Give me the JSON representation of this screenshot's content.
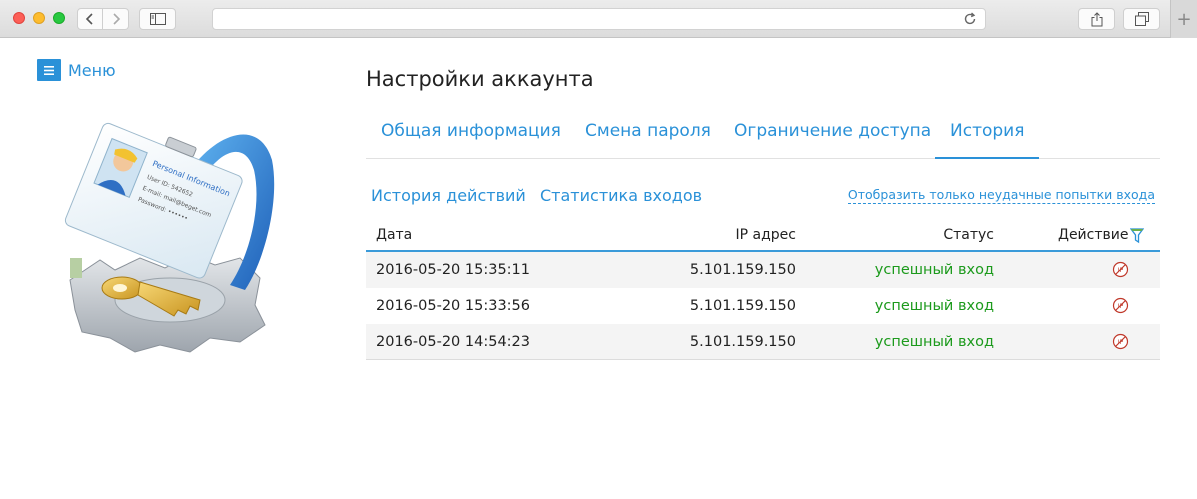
{
  "browser": {
    "new_tab_glyph": "+"
  },
  "menu": {
    "label": "Меню",
    "icon": "hamburger-icon"
  },
  "page": {
    "title": "Настройки аккаунта"
  },
  "tabs": [
    {
      "label": "Общая информация",
      "active": false
    },
    {
      "label": "Смена пароля",
      "active": false
    },
    {
      "label": "Ограничение доступа",
      "active": false
    },
    {
      "label": "История",
      "active": true
    }
  ],
  "subtabs": {
    "actions_history": "История действий",
    "login_stats": "Статистика входов",
    "failed_only_link": "Отобразить только неудачные попытки входа"
  },
  "table": {
    "columns": {
      "date": "Дата",
      "ip": "IP адрес",
      "status": "Статус",
      "action": "Действие"
    },
    "rows": [
      {
        "date": "2016-05-20 15:35:11",
        "ip": "5.101.159.150",
        "status": "успешный вход"
      },
      {
        "date": "2016-05-20 15:33:56",
        "ip": "5.101.159.150",
        "status": "успешный вход"
      },
      {
        "date": "2016-05-20 14:54:23",
        "ip": "5.101.159.150",
        "status": "успешный вход"
      }
    ]
  },
  "illustration": {
    "card_title": "Personal Information",
    "card_user_id": "User ID: 542652",
    "card_email": "E-mail: mail@beget.com",
    "card_password": "Password: ••••••"
  },
  "colors": {
    "accent": "#2a91d8",
    "success": "#1c9a1c",
    "block_icon": "#c0392b"
  }
}
